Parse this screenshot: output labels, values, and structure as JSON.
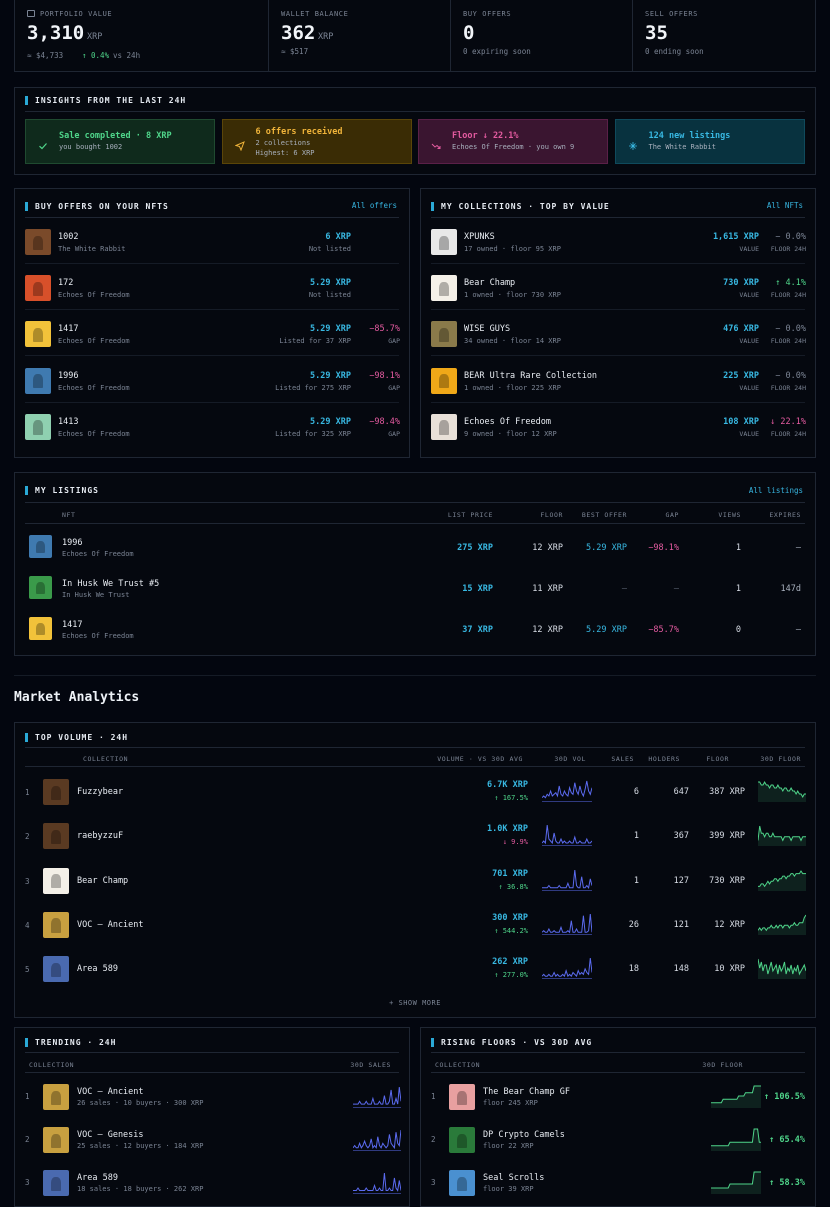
{
  "stats": [
    {
      "label": "PORTFOLIO VALUE",
      "value": "3,310",
      "unit": "XRP",
      "sub1": "≈ $4,733",
      "sub2": "↑ 0.4%",
      "sub3": "vs 24h"
    },
    {
      "label": "WALLET BALANCE",
      "value": "362",
      "unit": "XRP",
      "sub1": "≈ $517"
    },
    {
      "label": "BUY OFFERS",
      "value": "0",
      "sub1": "0 expiring soon"
    },
    {
      "label": "SELL OFFERS",
      "value": "35",
      "sub1": "0 ending soon"
    }
  ],
  "insights": {
    "title": "INSIGHTS FROM THE LAST 24H",
    "cards": [
      {
        "title": "Sale completed · 8 XRP",
        "sub": "you bought 1002",
        "sub2": "",
        "icon": "check-icon",
        "bg": "#0f2a1c",
        "border": "#1f4a30",
        "color": "#4fd58a"
      },
      {
        "title": "6 offers received",
        "sub": "2 collections",
        "sub2": "Highest: 6 XRP",
        "icon": "send-icon",
        "bg": "#3a2c05",
        "border": "#5a4508",
        "color": "#f0b43a"
      },
      {
        "title": "Floor ↓ 22.1%",
        "sub": "Echoes Of Freedom · you own 9",
        "sub2": "",
        "icon": "trend-down-icon",
        "bg": "#3a1530",
        "border": "#5a2048",
        "color": "#e45ba0"
      },
      {
        "title": "124 new listings",
        "sub": "The White Rabbit",
        "sub2": "",
        "icon": "sparkle-icon",
        "bg": "#08323f",
        "border": "#0f4a5c",
        "color": "#38b8e2"
      }
    ]
  },
  "buy_offers": {
    "title": "BUY OFFERS ON YOUR NFTS",
    "link": "All offers",
    "rows": [
      {
        "name": "1002",
        "collection": "The White Rabbit",
        "price": "6 XRP",
        "status": "Not listed",
        "gap": "",
        "gap_label": "",
        "thumb": "#7a4a2a"
      },
      {
        "name": "172",
        "collection": "Echoes Of Freedom",
        "price": "5.29 XRP",
        "status": "Not listed",
        "gap": "",
        "gap_label": "",
        "thumb": "#d8502a"
      },
      {
        "name": "1417",
        "collection": "Echoes Of Freedom",
        "price": "5.29 XRP",
        "status": "Listed for 37 XRP",
        "gap": "−85.7%",
        "gap_label": "GAP",
        "thumb": "#f2c23a"
      },
      {
        "name": "1996",
        "collection": "Echoes Of Freedom",
        "price": "5.29 XRP",
        "status": "Listed for 275 XRP",
        "gap": "−98.1%",
        "gap_label": "GAP",
        "thumb": "#3f7ab0"
      },
      {
        "name": "1413",
        "collection": "Echoes Of Freedom",
        "price": "5.29 XRP",
        "status": "Listed for 325 XRP",
        "gap": "−98.4%",
        "gap_label": "GAP",
        "thumb": "#8fd0b0"
      }
    ]
  },
  "collections": {
    "title": "MY COLLECTIONS · TOP BY VALUE",
    "link": "All NFTs",
    "rows": [
      {
        "name": "XPUNKS",
        "sub": "17 owned · floor 95 XRP",
        "value": "1,615 XRP",
        "value_label": "VALUE",
        "change": "− 0.0%",
        "change_label": "FLOOR 24H",
        "dir": "flat",
        "thumb": "#e8e8e8"
      },
      {
        "name": "Bear Champ",
        "sub": "1 owned · floor 730 XRP",
        "value": "730 XRP",
        "value_label": "VALUE",
        "change": "↑ 4.1%",
        "change_label": "FLOOR 24H",
        "dir": "up",
        "thumb": "#f4f0e8"
      },
      {
        "name": "WISE GUYS",
        "sub": "34 owned · floor 14 XRP",
        "value": "476 XRP",
        "value_label": "VALUE",
        "change": "− 0.0%",
        "change_label": "FLOOR 24H",
        "dir": "flat",
        "thumb": "#8a7a4a"
      },
      {
        "name": "BEAR Ultra Rare Collection",
        "sub": "1 owned · floor 225 XRP",
        "value": "225 XRP",
        "value_label": "VALUE",
        "change": "− 0.0%",
        "change_label": "FLOOR 24H",
        "dir": "flat",
        "thumb": "#f0a818"
      },
      {
        "name": "Echoes Of Freedom",
        "sub": "9 owned · floor 12 XRP",
        "value": "108 XRP",
        "value_label": "VALUE",
        "change": "↓ 22.1%",
        "change_label": "FLOOR 24H",
        "dir": "down",
        "thumb": "#e8e0d8"
      }
    ]
  },
  "listings": {
    "title": "MY LISTINGS",
    "link": "All listings",
    "headers": [
      "NFT",
      "LIST PRICE",
      "FLOOR",
      "BEST OFFER",
      "GAP",
      "VIEWS",
      "EXPIRES"
    ],
    "rows": [
      {
        "name": "1996",
        "collection": "Echoes Of Freedom",
        "list_price": "275 XRP",
        "floor": "12 XRP",
        "best_offer": "5.29 XRP",
        "gap": "−98.1%",
        "views": "1",
        "expires": "—",
        "thumb": "#3f7ab0"
      },
      {
        "name": "In Husk We Trust #5",
        "collection": "In Husk We Trust",
        "list_price": "15 XRP",
        "floor": "11 XRP",
        "best_offer": "—",
        "gap": "—",
        "views": "1",
        "expires": "147d",
        "thumb": "#3a9a4a"
      },
      {
        "name": "1417",
        "collection": "Echoes Of Freedom",
        "list_price": "37 XRP",
        "floor": "12 XRP",
        "best_offer": "5.29 XRP",
        "gap": "−85.7%",
        "views": "0",
        "expires": "—",
        "thumb": "#f2c23a"
      }
    ]
  },
  "market": {
    "heading": "Market Analytics",
    "top_volume": {
      "title": "TOP VOLUME · 24H",
      "headers": [
        "COLLECTION",
        "VOLUME · VS 30D AVG",
        "30D VOL",
        "SALES",
        "HOLDERS",
        "FLOOR",
        "30D FLOOR"
      ],
      "rows": [
        {
          "rank": "1",
          "name": "Fuzzybear",
          "volume": "6.7K XRP",
          "change": "↑ 167.5%",
          "dir": "up",
          "sales": "6",
          "holders": "647",
          "floor": "387 XRP",
          "thumb": "#5a3a22",
          "vol": [
            2,
            3,
            2,
            4,
            3,
            6,
            3,
            4,
            5,
            3,
            9,
            4,
            3,
            6,
            4,
            3,
            8,
            5,
            4,
            11,
            6,
            4,
            9,
            5,
            3,
            7,
            12,
            6,
            4,
            8
          ],
          "flr": [
            9,
            9,
            8,
            8,
            9,
            8,
            8,
            7,
            8,
            8,
            7,
            7,
            8,
            7,
            7,
            6,
            7,
            7,
            6,
            6,
            7,
            6,
            6,
            5,
            6,
            5,
            5,
            4,
            5,
            5
          ]
        },
        {
          "rank": "2",
          "name": "raebyzzuF",
          "volume": "1.0K XRP",
          "change": "↓ 9.9%",
          "dir": "down",
          "sales": "1",
          "holders": "367",
          "floor": "399 XRP",
          "thumb": "#5a3a22",
          "vol": [
            1,
            2,
            1,
            10,
            3,
            2,
            1,
            6,
            2,
            1,
            1,
            3,
            1,
            2,
            1,
            1,
            2,
            1,
            1,
            4,
            1,
            1,
            2,
            1,
            1,
            1,
            3,
            1,
            1,
            2
          ],
          "flr": [
            5,
            9,
            7,
            7,
            6,
            7,
            7,
            6,
            6,
            7,
            6,
            6,
            6,
            6,
            6,
            5,
            6,
            6,
            6,
            6,
            5,
            6,
            6,
            6,
            6,
            6,
            5,
            6,
            6,
            6
          ]
        },
        {
          "rank": "3",
          "name": "Bear Champ",
          "volume": "701 XRP",
          "change": "↑ 36.8%",
          "dir": "up",
          "sales": "1",
          "holders": "127",
          "floor": "730 XRP",
          "thumb": "#f4f0e8",
          "vol": [
            1,
            1,
            1,
            1,
            2,
            1,
            1,
            1,
            1,
            1,
            2,
            1,
            1,
            1,
            1,
            3,
            1,
            1,
            1,
            9,
            2,
            1,
            1,
            6,
            1,
            1,
            2,
            1,
            5,
            2
          ],
          "flr": [
            2,
            2,
            3,
            3,
            2,
            3,
            4,
            3,
            4,
            4,
            5,
            5,
            4,
            5,
            5,
            6,
            6,
            5,
            6,
            6,
            7,
            7,
            6,
            7,
            7,
            7,
            8,
            7,
            7,
            7
          ]
        },
        {
          "rank": "4",
          "name": "VOC – Ancient",
          "volume": "300 XRP",
          "change": "↑ 544.2%",
          "dir": "up",
          "sales": "26",
          "holders": "121",
          "floor": "12 XRP",
          "thumb": "#c8a040",
          "vol": [
            1,
            2,
            1,
            1,
            3,
            1,
            1,
            2,
            1,
            1,
            1,
            4,
            1,
            1,
            1,
            2,
            1,
            8,
            1,
            1,
            3,
            1,
            1,
            1,
            11,
            1,
            1,
            2,
            12,
            1
          ],
          "flr": [
            3,
            4,
            3,
            4,
            4,
            3,
            4,
            4,
            5,
            4,
            4,
            5,
            4,
            5,
            5,
            4,
            5,
            5,
            5,
            4,
            5,
            5,
            6,
            5,
            5,
            6,
            6,
            6,
            8,
            9
          ]
        },
        {
          "rank": "5",
          "name": "Area 589",
          "volume": "262 XRP",
          "change": "↑ 277.0%",
          "dir": "up",
          "sales": "18",
          "holders": "148",
          "floor": "10 XRP",
          "thumb": "#4a6ab0",
          "vol": [
            1,
            2,
            1,
            1,
            2,
            1,
            1,
            3,
            1,
            2,
            1,
            1,
            2,
            1,
            4,
            1,
            2,
            1,
            3,
            2,
            1,
            4,
            2,
            3,
            2,
            5,
            3,
            2,
            11,
            3
          ],
          "flr": [
            8,
            5,
            7,
            4,
            6,
            6,
            3,
            5,
            7,
            4,
            5,
            6,
            3,
            6,
            4,
            5,
            7,
            3,
            5,
            4,
            6,
            3,
            5,
            4,
            6,
            3,
            4,
            5,
            6,
            4
          ]
        }
      ],
      "show_more": "+ SHOW MORE"
    },
    "trending": {
      "title": "TRENDING · 24H",
      "headers": [
        "COLLECTION",
        "30D SALES"
      ],
      "rows": [
        {
          "rank": "1",
          "name": "VOC – Ancient",
          "sub": "26 sales · 10 buyers · 300 XRP",
          "thumb": "#c8a040",
          "spark": [
            1,
            1,
            1,
            1,
            2,
            1,
            1,
            1,
            2,
            1,
            1,
            1,
            3,
            1,
            1,
            1,
            2,
            1,
            1,
            4,
            1,
            1,
            2,
            6,
            1,
            1,
            3,
            1,
            7,
            2
          ]
        },
        {
          "rank": "2",
          "name": "VOC – Genesis",
          "sub": "25 sales · 12 buyers · 184 XRP",
          "thumb": "#c8a040",
          "spark": [
            1,
            2,
            1,
            1,
            3,
            1,
            2,
            4,
            2,
            1,
            2,
            5,
            1,
            2,
            1,
            6,
            2,
            1,
            3,
            2,
            1,
            2,
            7,
            3,
            2,
            1,
            8,
            3,
            2,
            9
          ]
        },
        {
          "rank": "3",
          "name": "Area 589",
          "sub": "18 sales · 18 buyers · 262 XRP",
          "thumb": "#4a6ab0",
          "spark": [
            1,
            1,
            1,
            2,
            1,
            1,
            1,
            1,
            2,
            1,
            1,
            1,
            1,
            3,
            1,
            1,
            2,
            1,
            1,
            8,
            1,
            1,
            2,
            1,
            1,
            6,
            2,
            1,
            5,
            1
          ]
        }
      ]
    },
    "rising": {
      "title": "RISING FLOORS · VS 30D AVG",
      "headers": [
        "COLLECTION",
        "30D FLOOR"
      ],
      "rows": [
        {
          "rank": "1",
          "name": "The Bear Champ GF",
          "sub": "floor 245 XRP",
          "change": "↑ 106.5%",
          "thumb": "#e8a0a0",
          "spark": [
            2,
            2,
            2,
            2,
            2,
            2,
            2,
            3,
            3,
            3,
            3,
            3,
            3,
            3,
            3,
            3,
            4,
            4,
            4,
            4,
            5,
            5,
            5,
            5,
            5,
            7,
            7,
            7,
            7,
            7
          ]
        },
        {
          "rank": "2",
          "name": "DP Crypto Camels",
          "sub": "floor 22 XRP",
          "change": "↑ 65.4%",
          "thumb": "#2a7a3a",
          "spark": [
            3,
            3,
            3,
            3,
            3,
            3,
            3,
            3,
            3,
            3,
            3,
            4,
            4,
            4,
            4,
            4,
            4,
            4,
            4,
            4,
            4,
            4,
            4,
            4,
            4,
            8,
            8,
            8,
            4,
            4
          ]
        },
        {
          "rank": "3",
          "name": "Seal Scrolls",
          "sub": "floor 39 XRP",
          "change": "↑ 58.3%",
          "thumb": "#4a90d0",
          "spark": [
            2,
            2,
            2,
            2,
            2,
            2,
            2,
            2,
            2,
            2,
            2,
            3,
            3,
            3,
            3,
            3,
            3,
            3,
            3,
            3,
            3,
            3,
            3,
            3,
            3,
            6,
            6,
            6,
            6,
            6
          ]
        }
      ]
    }
  }
}
